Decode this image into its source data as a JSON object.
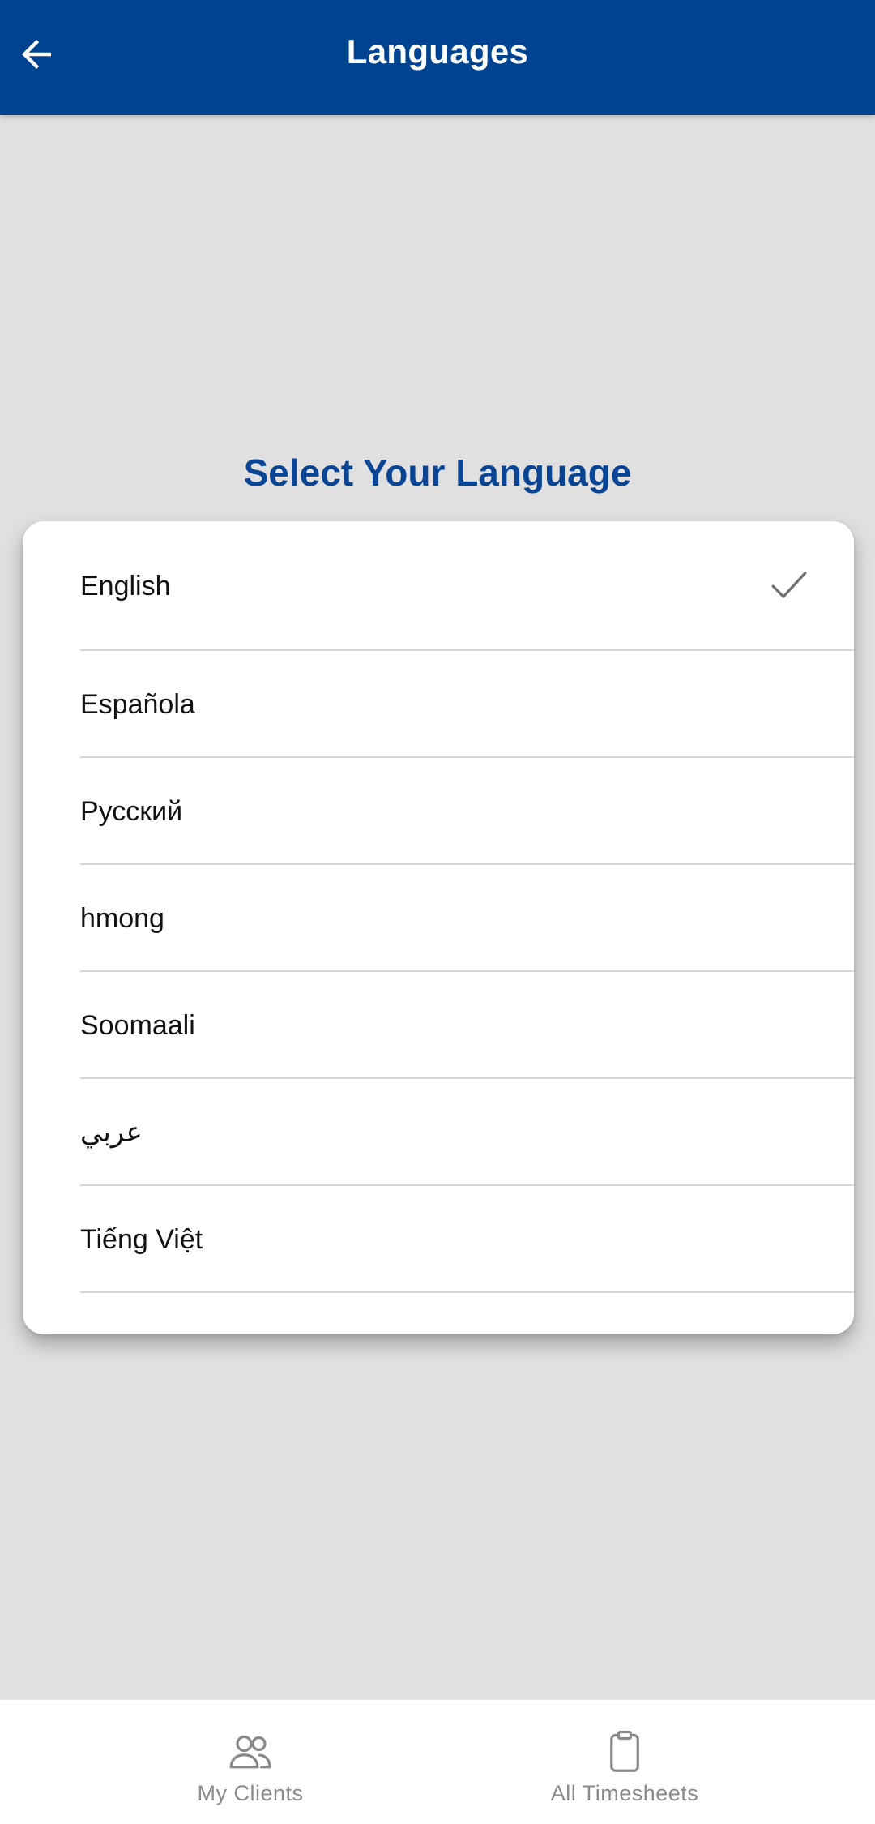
{
  "app_bar": {
    "title": "Languages",
    "background": "#004391",
    "back_icon": "arrow-left-icon"
  },
  "heading": "Select Your Language",
  "languages": [
    {
      "label": "English",
      "selected": true
    },
    {
      "label": "Española",
      "selected": false
    },
    {
      "label": "Русский",
      "selected": false
    },
    {
      "label": "hmong",
      "selected": false
    },
    {
      "label": "Soomaali",
      "selected": false
    },
    {
      "label": "عربي",
      "selected": false
    },
    {
      "label": "Tiếng Việt",
      "selected": false
    }
  ],
  "selected_icon": "check-icon",
  "bottom_nav": {
    "items": [
      {
        "label": "My Clients",
        "icon": "people-icon"
      },
      {
        "label": "All Timesheets",
        "icon": "clipboard-icon"
      }
    ]
  },
  "colors": {
    "primary": "#004391",
    "heading": "#0a4595",
    "page_background": "#e0e0e0",
    "nav_inactive": "#8a8a8a"
  }
}
